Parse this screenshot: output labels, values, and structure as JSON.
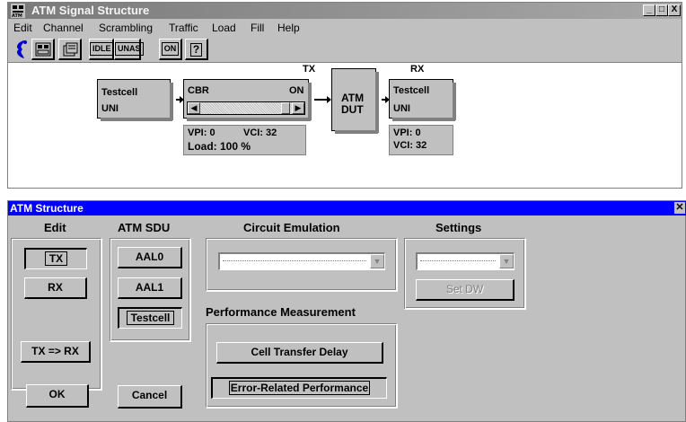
{
  "signal_window": {
    "title": "ATM Signal Structure",
    "controls": [
      "_",
      "□",
      "X"
    ],
    "menu": [
      "Edit",
      "Channel",
      "Scrambling",
      "Traffic",
      "Load",
      "Fill",
      "Help"
    ],
    "toolbar": [
      {
        "icon": "pointer-icon"
      },
      {
        "icon": "cell-structure-icon"
      },
      {
        "icon": "cell-header-icon"
      },
      {
        "label": "IDLE"
      },
      {
        "label": "UNAS"
      },
      {
        "label": "ON"
      },
      {
        "label": "?"
      }
    ],
    "diagram": {
      "tx_label": "TX",
      "rx_label": "RX",
      "tx_source": {
        "title": "Testcell",
        "subtitle": "UNI"
      },
      "tx_traffic": {
        "type": "CBR",
        "state": "ON",
        "vpi": "VPI: 0",
        "vci": "VCI: 32",
        "load": "Load: 100 %"
      },
      "dut": {
        "line1": "ATM",
        "line2": "DUT"
      },
      "rx_sink": {
        "title": "Testcell",
        "subtitle": "UNI",
        "vpi": "VPI: 0",
        "vci": "VCI: 32"
      }
    }
  },
  "structure_window": {
    "title": "ATM Structure",
    "edit": {
      "heading": "Edit",
      "tx": "TX",
      "rx": "RX",
      "copy": "TX => RX"
    },
    "sdu": {
      "heading": "ATM SDU",
      "aal0": "AAL0",
      "aal1": "AAL1",
      "testcell": "Testcell"
    },
    "circuit": {
      "heading": "Circuit Emulation"
    },
    "settings": {
      "heading": "Settings",
      "set_dw": "Set DW"
    },
    "performance": {
      "heading": "Performance Measurement",
      "ctd": "Cell Transfer Delay",
      "erp": "Error-Related Performance"
    },
    "ok": "OK",
    "cancel": "Cancel"
  }
}
